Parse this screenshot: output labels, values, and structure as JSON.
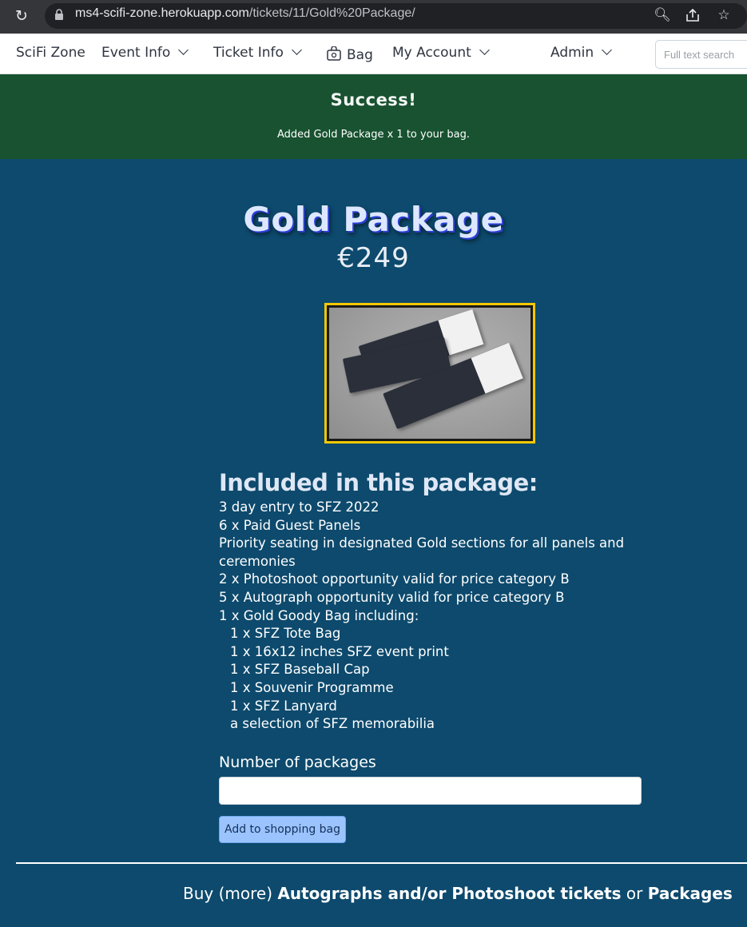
{
  "browser": {
    "url_host": "ms4-scifi-zone.herokuapp.com",
    "url_path": "/tickets/11/Gold%20Package/"
  },
  "navbar": {
    "brand": "SciFi Zone",
    "items": [
      {
        "label": "Event Info",
        "has_dropdown": true
      },
      {
        "label": "Ticket Info",
        "has_dropdown": true
      },
      {
        "label": "Bag",
        "icon": "bag-icon"
      },
      {
        "label": "My Account",
        "has_dropdown": true
      },
      {
        "label": "Admin",
        "has_dropdown": true
      }
    ],
    "search_placeholder": "Full text search"
  },
  "alert": {
    "title": "Success!",
    "message": "Added Gold Package x 1 to your bag."
  },
  "product": {
    "title": "Gold Package",
    "price": "€249",
    "image_alt": "tickets-image",
    "includes_heading": "Included in this package:",
    "includes": [
      {
        "text": "3 day entry to SFZ 2022",
        "sub": false
      },
      {
        "text": "6 x Paid Guest Panels",
        "sub": false
      },
      {
        "text": "Priority seating in designated Gold sections for all panels and ceremonies",
        "sub": false
      },
      {
        "text": "2 x Photoshoot opportunity valid for price category B",
        "sub": false
      },
      {
        "text": "5 x Autograph opportunity valid for price category B",
        "sub": false
      },
      {
        "text": "1 x Gold Goody Bag including:",
        "sub": false
      },
      {
        "text": "1 x SFZ Tote Bag",
        "sub": true
      },
      {
        "text": "1 x 16x12 inches SFZ event print",
        "sub": true
      },
      {
        "text": "1 x SFZ Baseball Cap",
        "sub": true
      },
      {
        "text": "1 x Souvenir Programme",
        "sub": true
      },
      {
        "text": "1 x SFZ Lanyard",
        "sub": true
      },
      {
        "text": "a selection of SFZ memorabilia",
        "sub": true
      }
    ]
  },
  "form": {
    "qty_label": "Number of packages",
    "qty_value": "",
    "add_button": "Add to shopping bag"
  },
  "footer": {
    "prefix": "Buy (more) ",
    "link1": "Autographs and/or Photoshoot tickets",
    "middle": " or ",
    "link2": "Packages"
  },
  "colors": {
    "page_bg": "#0d4a6d",
    "alert_bg": "#185230",
    "image_border": "#f4c800",
    "button_bg": "#9bc4ff"
  }
}
